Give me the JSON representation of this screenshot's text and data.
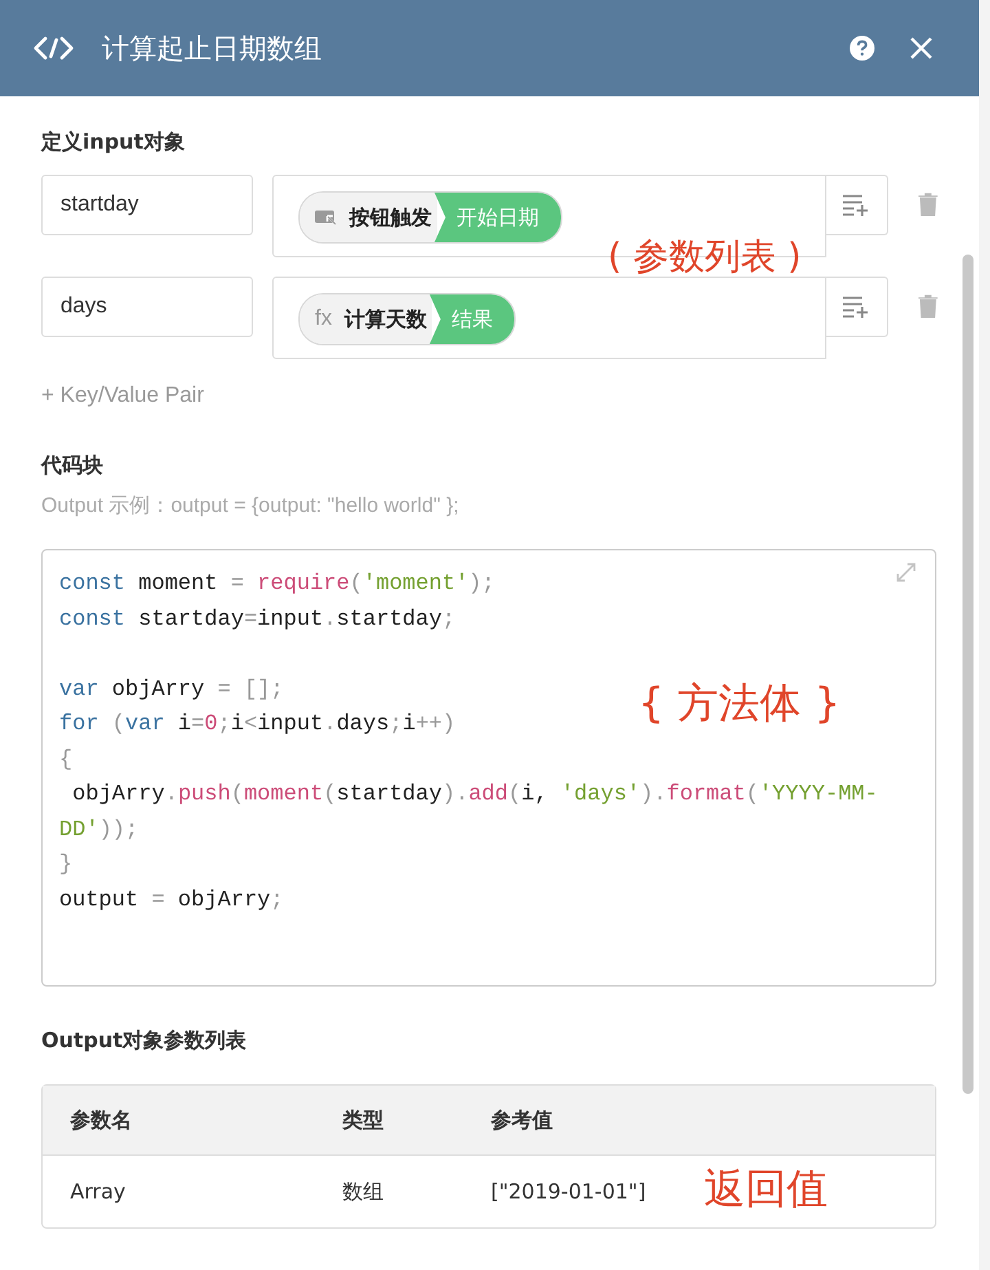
{
  "window": {
    "title": "计算起止日期数组"
  },
  "input_section": {
    "heading": "定义input对象",
    "annotation": "( 参数列表 )",
    "pairs": [
      {
        "key": "startday",
        "pill": {
          "kind": "button",
          "source": "按钮触发",
          "value": "开始日期"
        }
      },
      {
        "key": "days",
        "pill": {
          "kind": "function",
          "icon_text": "fx",
          "source": "计算天数",
          "value": "结果"
        }
      }
    ],
    "add_link": "+ Key/Value Pair"
  },
  "code_section": {
    "heading": "代码块",
    "hint": "Output 示例：output = {output: \"hello world\" };",
    "annotation": "{ 方法体 }",
    "lines": [
      {
        "kind": "code",
        "tokens": [
          {
            "text": "const",
            "kind": "keyword"
          },
          {
            "text": " moment ",
            "kind": "plain"
          },
          {
            "text": "= ",
            "kind": "punct"
          },
          {
            "text": "require",
            "kind": "call"
          },
          {
            "text": "(",
            "kind": "punct"
          },
          {
            "text": "'moment'",
            "kind": "string"
          },
          {
            "text": ");",
            "kind": "punct"
          }
        ]
      },
      {
        "kind": "code",
        "tokens": [
          {
            "text": "const",
            "kind": "keyword"
          },
          {
            "text": " startday",
            "kind": "plain"
          },
          {
            "text": "=",
            "kind": "punct"
          },
          {
            "text": "input",
            "kind": "plain"
          },
          {
            "text": ".",
            "kind": "punct"
          },
          {
            "text": "startday",
            "kind": "plain"
          },
          {
            "text": ";",
            "kind": "punct"
          }
        ]
      },
      {
        "kind": "blank"
      },
      {
        "kind": "code",
        "tokens": [
          {
            "text": "var",
            "kind": "keyword"
          },
          {
            "text": " objArry ",
            "kind": "plain"
          },
          {
            "text": "= [];",
            "kind": "punct"
          }
        ]
      },
      {
        "kind": "code",
        "tokens": [
          {
            "text": "for",
            "kind": "keyword"
          },
          {
            "text": " (",
            "kind": "punct"
          },
          {
            "text": "var",
            "kind": "keyword"
          },
          {
            "text": " i",
            "kind": "plain"
          },
          {
            "text": "=",
            "kind": "punct"
          },
          {
            "text": "0",
            "kind": "call"
          },
          {
            "text": ";",
            "kind": "punct"
          },
          {
            "text": "i",
            "kind": "plain"
          },
          {
            "text": "<",
            "kind": "punct"
          },
          {
            "text": "input",
            "kind": "plain"
          },
          {
            "text": ".",
            "kind": "punct"
          },
          {
            "text": "days",
            "kind": "plain"
          },
          {
            "text": ";",
            "kind": "punct"
          },
          {
            "text": "i",
            "kind": "plain"
          },
          {
            "text": "++)",
            "kind": "punct"
          }
        ]
      },
      {
        "kind": "code",
        "tokens": [
          {
            "text": "{",
            "kind": "punct"
          }
        ]
      },
      {
        "kind": "code",
        "tokens": [
          {
            "text": " objArry",
            "kind": "plain"
          },
          {
            "text": ".",
            "kind": "punct"
          },
          {
            "text": "push",
            "kind": "call"
          },
          {
            "text": "(",
            "kind": "punct"
          },
          {
            "text": "moment",
            "kind": "call"
          },
          {
            "text": "(",
            "kind": "punct"
          },
          {
            "text": "startday",
            "kind": "plain"
          },
          {
            "text": ").",
            "kind": "punct"
          },
          {
            "text": "add",
            "kind": "call"
          },
          {
            "text": "(",
            "kind": "punct"
          },
          {
            "text": "i, ",
            "kind": "plain"
          },
          {
            "text": "'days'",
            "kind": "string"
          },
          {
            "text": ").",
            "kind": "punct"
          },
          {
            "text": "format",
            "kind": "call"
          },
          {
            "text": "(",
            "kind": "punct"
          },
          {
            "text": "'YYYY-MM-DD'",
            "kind": "string"
          },
          {
            "text": "));",
            "kind": "punct"
          }
        ]
      },
      {
        "kind": "code",
        "tokens": [
          {
            "text": "}",
            "kind": "punct"
          }
        ]
      },
      {
        "kind": "code",
        "tokens": [
          {
            "text": "output ",
            "kind": "plain"
          },
          {
            "text": "=",
            "kind": "punct"
          },
          {
            "text": " objArry",
            "kind": "plain"
          },
          {
            "text": ";",
            "kind": "punct"
          }
        ]
      }
    ]
  },
  "output_section": {
    "heading": "Output对象参数列表",
    "annotation": "返回值",
    "table": {
      "columns": [
        "参数名",
        "类型",
        "参考值"
      ],
      "rows": [
        [
          "Array",
          "数组",
          "[\"2019-01-01\"]"
        ]
      ]
    }
  }
}
